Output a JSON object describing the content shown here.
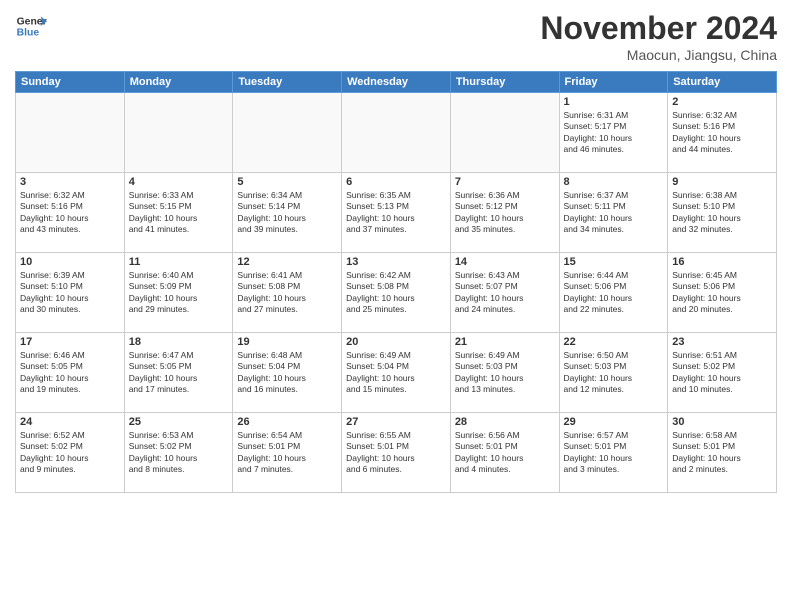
{
  "logo": {
    "text_line1": "General",
    "text_line2": "Blue"
  },
  "title": "November 2024",
  "location": "Maocun, Jiangsu, China",
  "days_of_week": [
    "Sunday",
    "Monday",
    "Tuesday",
    "Wednesday",
    "Thursday",
    "Friday",
    "Saturday"
  ],
  "weeks": [
    [
      {
        "day": "",
        "info": ""
      },
      {
        "day": "",
        "info": ""
      },
      {
        "day": "",
        "info": ""
      },
      {
        "day": "",
        "info": ""
      },
      {
        "day": "",
        "info": ""
      },
      {
        "day": "1",
        "info": "Sunrise: 6:31 AM\nSunset: 5:17 PM\nDaylight: 10 hours\nand 46 minutes."
      },
      {
        "day": "2",
        "info": "Sunrise: 6:32 AM\nSunset: 5:16 PM\nDaylight: 10 hours\nand 44 minutes."
      }
    ],
    [
      {
        "day": "3",
        "info": "Sunrise: 6:32 AM\nSunset: 5:16 PM\nDaylight: 10 hours\nand 43 minutes."
      },
      {
        "day": "4",
        "info": "Sunrise: 6:33 AM\nSunset: 5:15 PM\nDaylight: 10 hours\nand 41 minutes."
      },
      {
        "day": "5",
        "info": "Sunrise: 6:34 AM\nSunset: 5:14 PM\nDaylight: 10 hours\nand 39 minutes."
      },
      {
        "day": "6",
        "info": "Sunrise: 6:35 AM\nSunset: 5:13 PM\nDaylight: 10 hours\nand 37 minutes."
      },
      {
        "day": "7",
        "info": "Sunrise: 6:36 AM\nSunset: 5:12 PM\nDaylight: 10 hours\nand 35 minutes."
      },
      {
        "day": "8",
        "info": "Sunrise: 6:37 AM\nSunset: 5:11 PM\nDaylight: 10 hours\nand 34 minutes."
      },
      {
        "day": "9",
        "info": "Sunrise: 6:38 AM\nSunset: 5:10 PM\nDaylight: 10 hours\nand 32 minutes."
      }
    ],
    [
      {
        "day": "10",
        "info": "Sunrise: 6:39 AM\nSunset: 5:10 PM\nDaylight: 10 hours\nand 30 minutes."
      },
      {
        "day": "11",
        "info": "Sunrise: 6:40 AM\nSunset: 5:09 PM\nDaylight: 10 hours\nand 29 minutes."
      },
      {
        "day": "12",
        "info": "Sunrise: 6:41 AM\nSunset: 5:08 PM\nDaylight: 10 hours\nand 27 minutes."
      },
      {
        "day": "13",
        "info": "Sunrise: 6:42 AM\nSunset: 5:08 PM\nDaylight: 10 hours\nand 25 minutes."
      },
      {
        "day": "14",
        "info": "Sunrise: 6:43 AM\nSunset: 5:07 PM\nDaylight: 10 hours\nand 24 minutes."
      },
      {
        "day": "15",
        "info": "Sunrise: 6:44 AM\nSunset: 5:06 PM\nDaylight: 10 hours\nand 22 minutes."
      },
      {
        "day": "16",
        "info": "Sunrise: 6:45 AM\nSunset: 5:06 PM\nDaylight: 10 hours\nand 20 minutes."
      }
    ],
    [
      {
        "day": "17",
        "info": "Sunrise: 6:46 AM\nSunset: 5:05 PM\nDaylight: 10 hours\nand 19 minutes."
      },
      {
        "day": "18",
        "info": "Sunrise: 6:47 AM\nSunset: 5:05 PM\nDaylight: 10 hours\nand 17 minutes."
      },
      {
        "day": "19",
        "info": "Sunrise: 6:48 AM\nSunset: 5:04 PM\nDaylight: 10 hours\nand 16 minutes."
      },
      {
        "day": "20",
        "info": "Sunrise: 6:49 AM\nSunset: 5:04 PM\nDaylight: 10 hours\nand 15 minutes."
      },
      {
        "day": "21",
        "info": "Sunrise: 6:49 AM\nSunset: 5:03 PM\nDaylight: 10 hours\nand 13 minutes."
      },
      {
        "day": "22",
        "info": "Sunrise: 6:50 AM\nSunset: 5:03 PM\nDaylight: 10 hours\nand 12 minutes."
      },
      {
        "day": "23",
        "info": "Sunrise: 6:51 AM\nSunset: 5:02 PM\nDaylight: 10 hours\nand 10 minutes."
      }
    ],
    [
      {
        "day": "24",
        "info": "Sunrise: 6:52 AM\nSunset: 5:02 PM\nDaylight: 10 hours\nand 9 minutes."
      },
      {
        "day": "25",
        "info": "Sunrise: 6:53 AM\nSunset: 5:02 PM\nDaylight: 10 hours\nand 8 minutes."
      },
      {
        "day": "26",
        "info": "Sunrise: 6:54 AM\nSunset: 5:01 PM\nDaylight: 10 hours\nand 7 minutes."
      },
      {
        "day": "27",
        "info": "Sunrise: 6:55 AM\nSunset: 5:01 PM\nDaylight: 10 hours\nand 6 minutes."
      },
      {
        "day": "28",
        "info": "Sunrise: 6:56 AM\nSunset: 5:01 PM\nDaylight: 10 hours\nand 4 minutes."
      },
      {
        "day": "29",
        "info": "Sunrise: 6:57 AM\nSunset: 5:01 PM\nDaylight: 10 hours\nand 3 minutes."
      },
      {
        "day": "30",
        "info": "Sunrise: 6:58 AM\nSunset: 5:01 PM\nDaylight: 10 hours\nand 2 minutes."
      }
    ]
  ]
}
